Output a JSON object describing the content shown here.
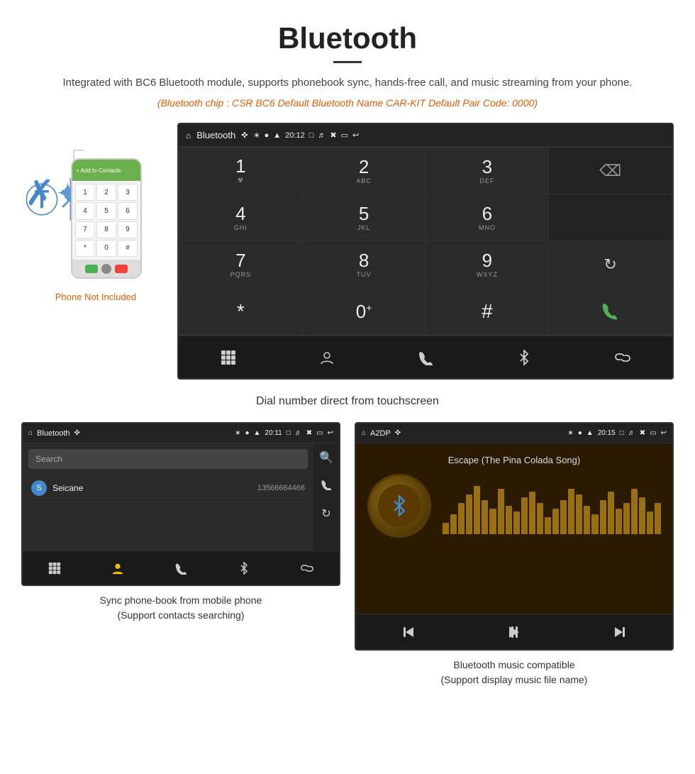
{
  "title": "Bluetooth",
  "subtitle": "Integrated with BC6 Bluetooth module, supports phonebook sync, hands-free call, and music streaming from your phone.",
  "chip_info": "(Bluetooth chip : CSR BC6    Default Bluetooth Name CAR-KIT    Default Pair Code: 0000)",
  "phone_not_included": "Phone Not Included",
  "dial_caption": "Dial number direct from touchscreen",
  "contacts_caption": "Sync phone-book from mobile phone\n(Support contacts searching)",
  "music_caption": "Bluetooth music compatible\n(Support display music file name)",
  "statusbar": {
    "bluetooth_title": "Bluetooth",
    "time": "20:12",
    "a2dp_title": "A2DP",
    "time2": "20:15",
    "time3": "20:11"
  },
  "dialpad": {
    "keys": [
      {
        "num": "1",
        "sub": ""
      },
      {
        "num": "2",
        "sub": "ABC"
      },
      {
        "num": "3",
        "sub": "DEF"
      },
      {
        "num": "4",
        "sub": "GHI"
      },
      {
        "num": "5",
        "sub": "JKL"
      },
      {
        "num": "6",
        "sub": "MNO"
      },
      {
        "num": "7",
        "sub": "PQRS"
      },
      {
        "num": "8",
        "sub": "TUV"
      },
      {
        "num": "9",
        "sub": "WXYZ"
      },
      {
        "num": "*",
        "sub": ""
      },
      {
        "num": "0+",
        "sub": ""
      },
      {
        "num": "#",
        "sub": ""
      }
    ]
  },
  "contacts": {
    "search_placeholder": "Search",
    "contact_letter": "S",
    "contact_name": "Seicane",
    "contact_number": "13566664466"
  },
  "music": {
    "song_title": "Escape (The Pina Colada Song)",
    "bars": [
      20,
      35,
      55,
      70,
      85,
      60,
      45,
      80,
      50,
      40,
      65,
      75,
      55,
      30,
      45,
      60,
      80,
      70,
      50,
      35,
      60,
      75,
      45,
      55,
      80,
      65,
      40,
      55
    ]
  }
}
